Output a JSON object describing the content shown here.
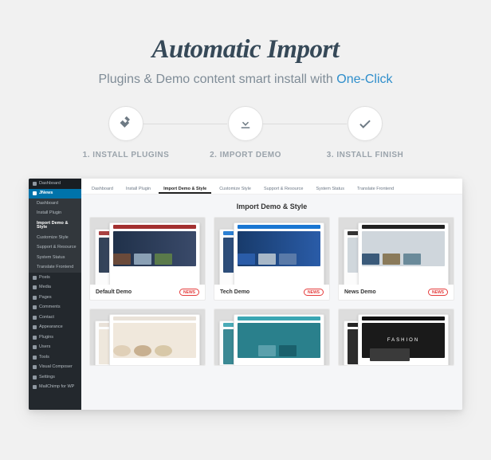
{
  "hero": {
    "title": "Automatic Import",
    "subtitle": "Plugins & Demo content smart install with ",
    "accent": "One-Click"
  },
  "steps": [
    {
      "label": "1. INSTALL PLUGINS"
    },
    {
      "label": "2. IMPORT DEMO"
    },
    {
      "label": "3. INSTALL FINISH"
    }
  ],
  "admin": {
    "top": "Dashboard",
    "active": "JNews",
    "sub": [
      "Dashboard",
      "Install Plugin",
      "Import Demo & Style",
      "Customize Style",
      "Support & Resource",
      "System Status",
      "Translate Frontend"
    ],
    "sub_selected_index": 2,
    "menu": [
      "Posts",
      "Media",
      "Pages",
      "Comments",
      "Contact",
      "Appearance",
      "Plugins",
      "Users",
      "Tools",
      "Visual Composer",
      "Settings",
      "MailChimp for WP"
    ],
    "tabs": [
      "Dashboard",
      "Install Plugin",
      "Import Demo & Style",
      "Customize Style",
      "Support & Resource",
      "System Status",
      "Translate Frontend"
    ],
    "tabs_active_index": 2,
    "panel_title": "Import Demo & Style",
    "pill": "NEWS",
    "demos_row1": [
      "Default Demo",
      "Tech Demo",
      "News Demo"
    ]
  }
}
